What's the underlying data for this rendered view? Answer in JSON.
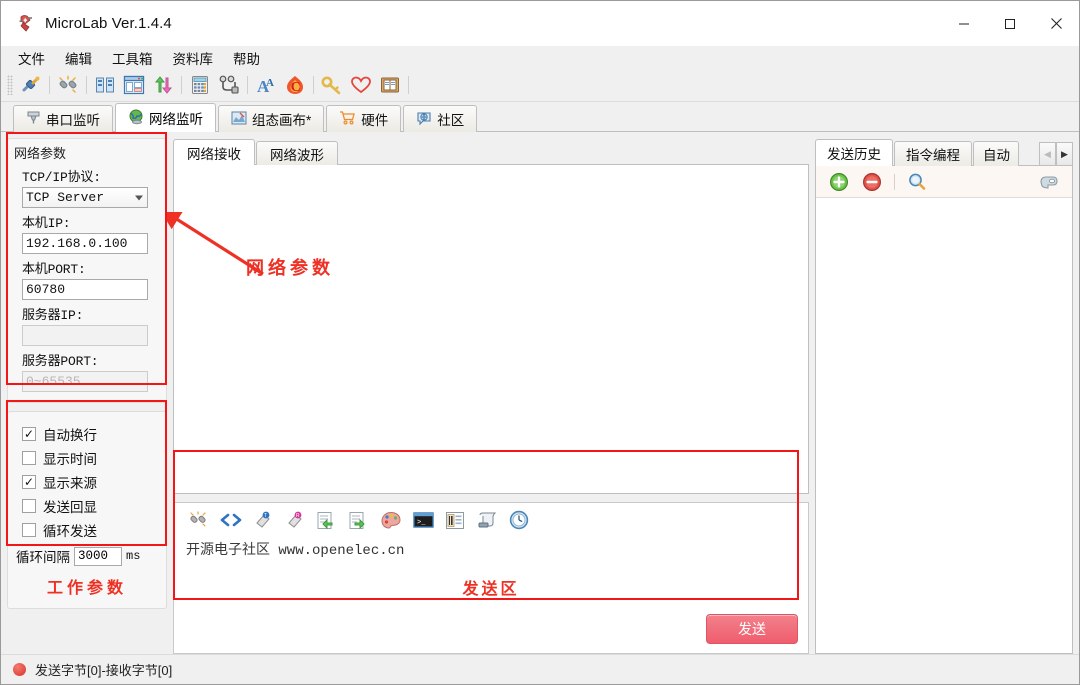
{
  "window": {
    "title": "MicroLab Ver.1.4.4",
    "app_icon": "swiss-knife-icon",
    "minimize": "—",
    "maximize": "▢",
    "close": "✕"
  },
  "menubar": {
    "items": [
      {
        "label": "文件"
      },
      {
        "label": "编辑"
      },
      {
        "label": "工具箱"
      },
      {
        "label": "资料库"
      },
      {
        "label": "帮助"
      }
    ]
  },
  "toolbar": {
    "buttons": [
      {
        "name": "connect-icon",
        "glyph": "🔌"
      },
      {
        "name": "disconnect-icon",
        "glyph": "⛓"
      },
      {
        "name": "split-columns-icon",
        "glyph": "▮▮"
      },
      {
        "name": "window-layout-icon",
        "glyph": "🗔"
      },
      {
        "name": "updown-arrows-icon",
        "glyph": "⇅"
      },
      {
        "name": "calculator-icon",
        "glyph": "🧮"
      },
      {
        "name": "network-nodes-icon",
        "glyph": "⚯"
      },
      {
        "name": "font-icon",
        "glyph": "A"
      },
      {
        "name": "c-flame-icon",
        "glyph": "C"
      },
      {
        "name": "key-icon",
        "glyph": "🔑"
      },
      {
        "name": "heart-icon",
        "glyph": "♡"
      },
      {
        "name": "book-icon",
        "glyph": "📖"
      }
    ]
  },
  "main_tabs": [
    {
      "label": "串口监听",
      "icon": "serial-port-icon",
      "active": false
    },
    {
      "label": "网络监听",
      "icon": "globe-icon",
      "active": true
    },
    {
      "label": "组态画布*",
      "icon": "canvas-icon",
      "active": false
    },
    {
      "label": "硬件",
      "icon": "cart-icon",
      "active": false
    },
    {
      "label": "社区",
      "icon": "community-icon",
      "active": false
    }
  ],
  "network_params": {
    "group_title": "网络参数",
    "protocol_label": "TCP/IP协议:",
    "protocol_value": "TCP Server",
    "local_ip_label": "本机IP:",
    "local_ip_value": "192.168.0.100",
    "local_port_label": "本机PORT:",
    "local_port_value": "60780",
    "server_ip_label": "服务器IP:",
    "server_ip_value": "",
    "server_port_label": "服务器PORT:",
    "server_port_placeholder": "0~65535"
  },
  "work_params": {
    "checkboxes": [
      {
        "label": "自动换行",
        "checked": true
      },
      {
        "label": "显示时间",
        "checked": false
      },
      {
        "label": "显示来源",
        "checked": true
      },
      {
        "label": "发送回显",
        "checked": false
      },
      {
        "label": "循环发送",
        "checked": false
      }
    ],
    "interval_label": "循环间隔",
    "interval_value": "3000",
    "interval_unit": "ms",
    "note": "工作参数"
  },
  "center": {
    "tabs": [
      {
        "label": "网络接收",
        "active": true
      },
      {
        "label": "网络波形",
        "active": false
      }
    ],
    "receive_content": ""
  },
  "send_area": {
    "toolbar_icons": [
      {
        "name": "break-link-icon",
        "glyph": "⛓"
      },
      {
        "name": "code-brackets-icon",
        "glyph": "<>"
      },
      {
        "name": "eraser-text-icon",
        "glyph": "T"
      },
      {
        "name": "eraser-recv-icon",
        "glyph": "R"
      },
      {
        "name": "import-file-icon",
        "glyph": "⬅"
      },
      {
        "name": "export-file-icon",
        "glyph": "➡"
      },
      {
        "name": "palette-icon",
        "glyph": "🎨"
      },
      {
        "name": "terminal-icon",
        "glyph": "▮"
      },
      {
        "name": "hex-view-icon",
        "glyph": "▤"
      },
      {
        "name": "scroll-icon",
        "glyph": "📜"
      },
      {
        "name": "clock-icon",
        "glyph": "🕐"
      }
    ],
    "content_cn": "开源电子社区",
    "content_url": "www.openelec.cn",
    "note": "发送区",
    "send_button": "发送"
  },
  "right_panel": {
    "tabs": [
      {
        "label": "发送历史",
        "active": true
      },
      {
        "label": "指令编程",
        "active": false
      },
      {
        "label": "自动",
        "active": false,
        "clipped": true
      }
    ],
    "scroll_left": "◀",
    "scroll_right": "▶",
    "toolbar_icons": [
      {
        "name": "add-icon",
        "glyph": "+"
      },
      {
        "name": "remove-icon",
        "glyph": "−"
      },
      {
        "name": "search-icon",
        "glyph": "🔍"
      },
      {
        "name": "pointing-hand-icon",
        "glyph": "☞"
      }
    ]
  },
  "statusbar": {
    "indicator": "status-dot-red",
    "text": "发送字节[0]-接收字节[0]"
  },
  "annotations": {
    "network_params_label": "网络参数",
    "accent_red": "#ee3124",
    "box_red": "#f41616"
  }
}
